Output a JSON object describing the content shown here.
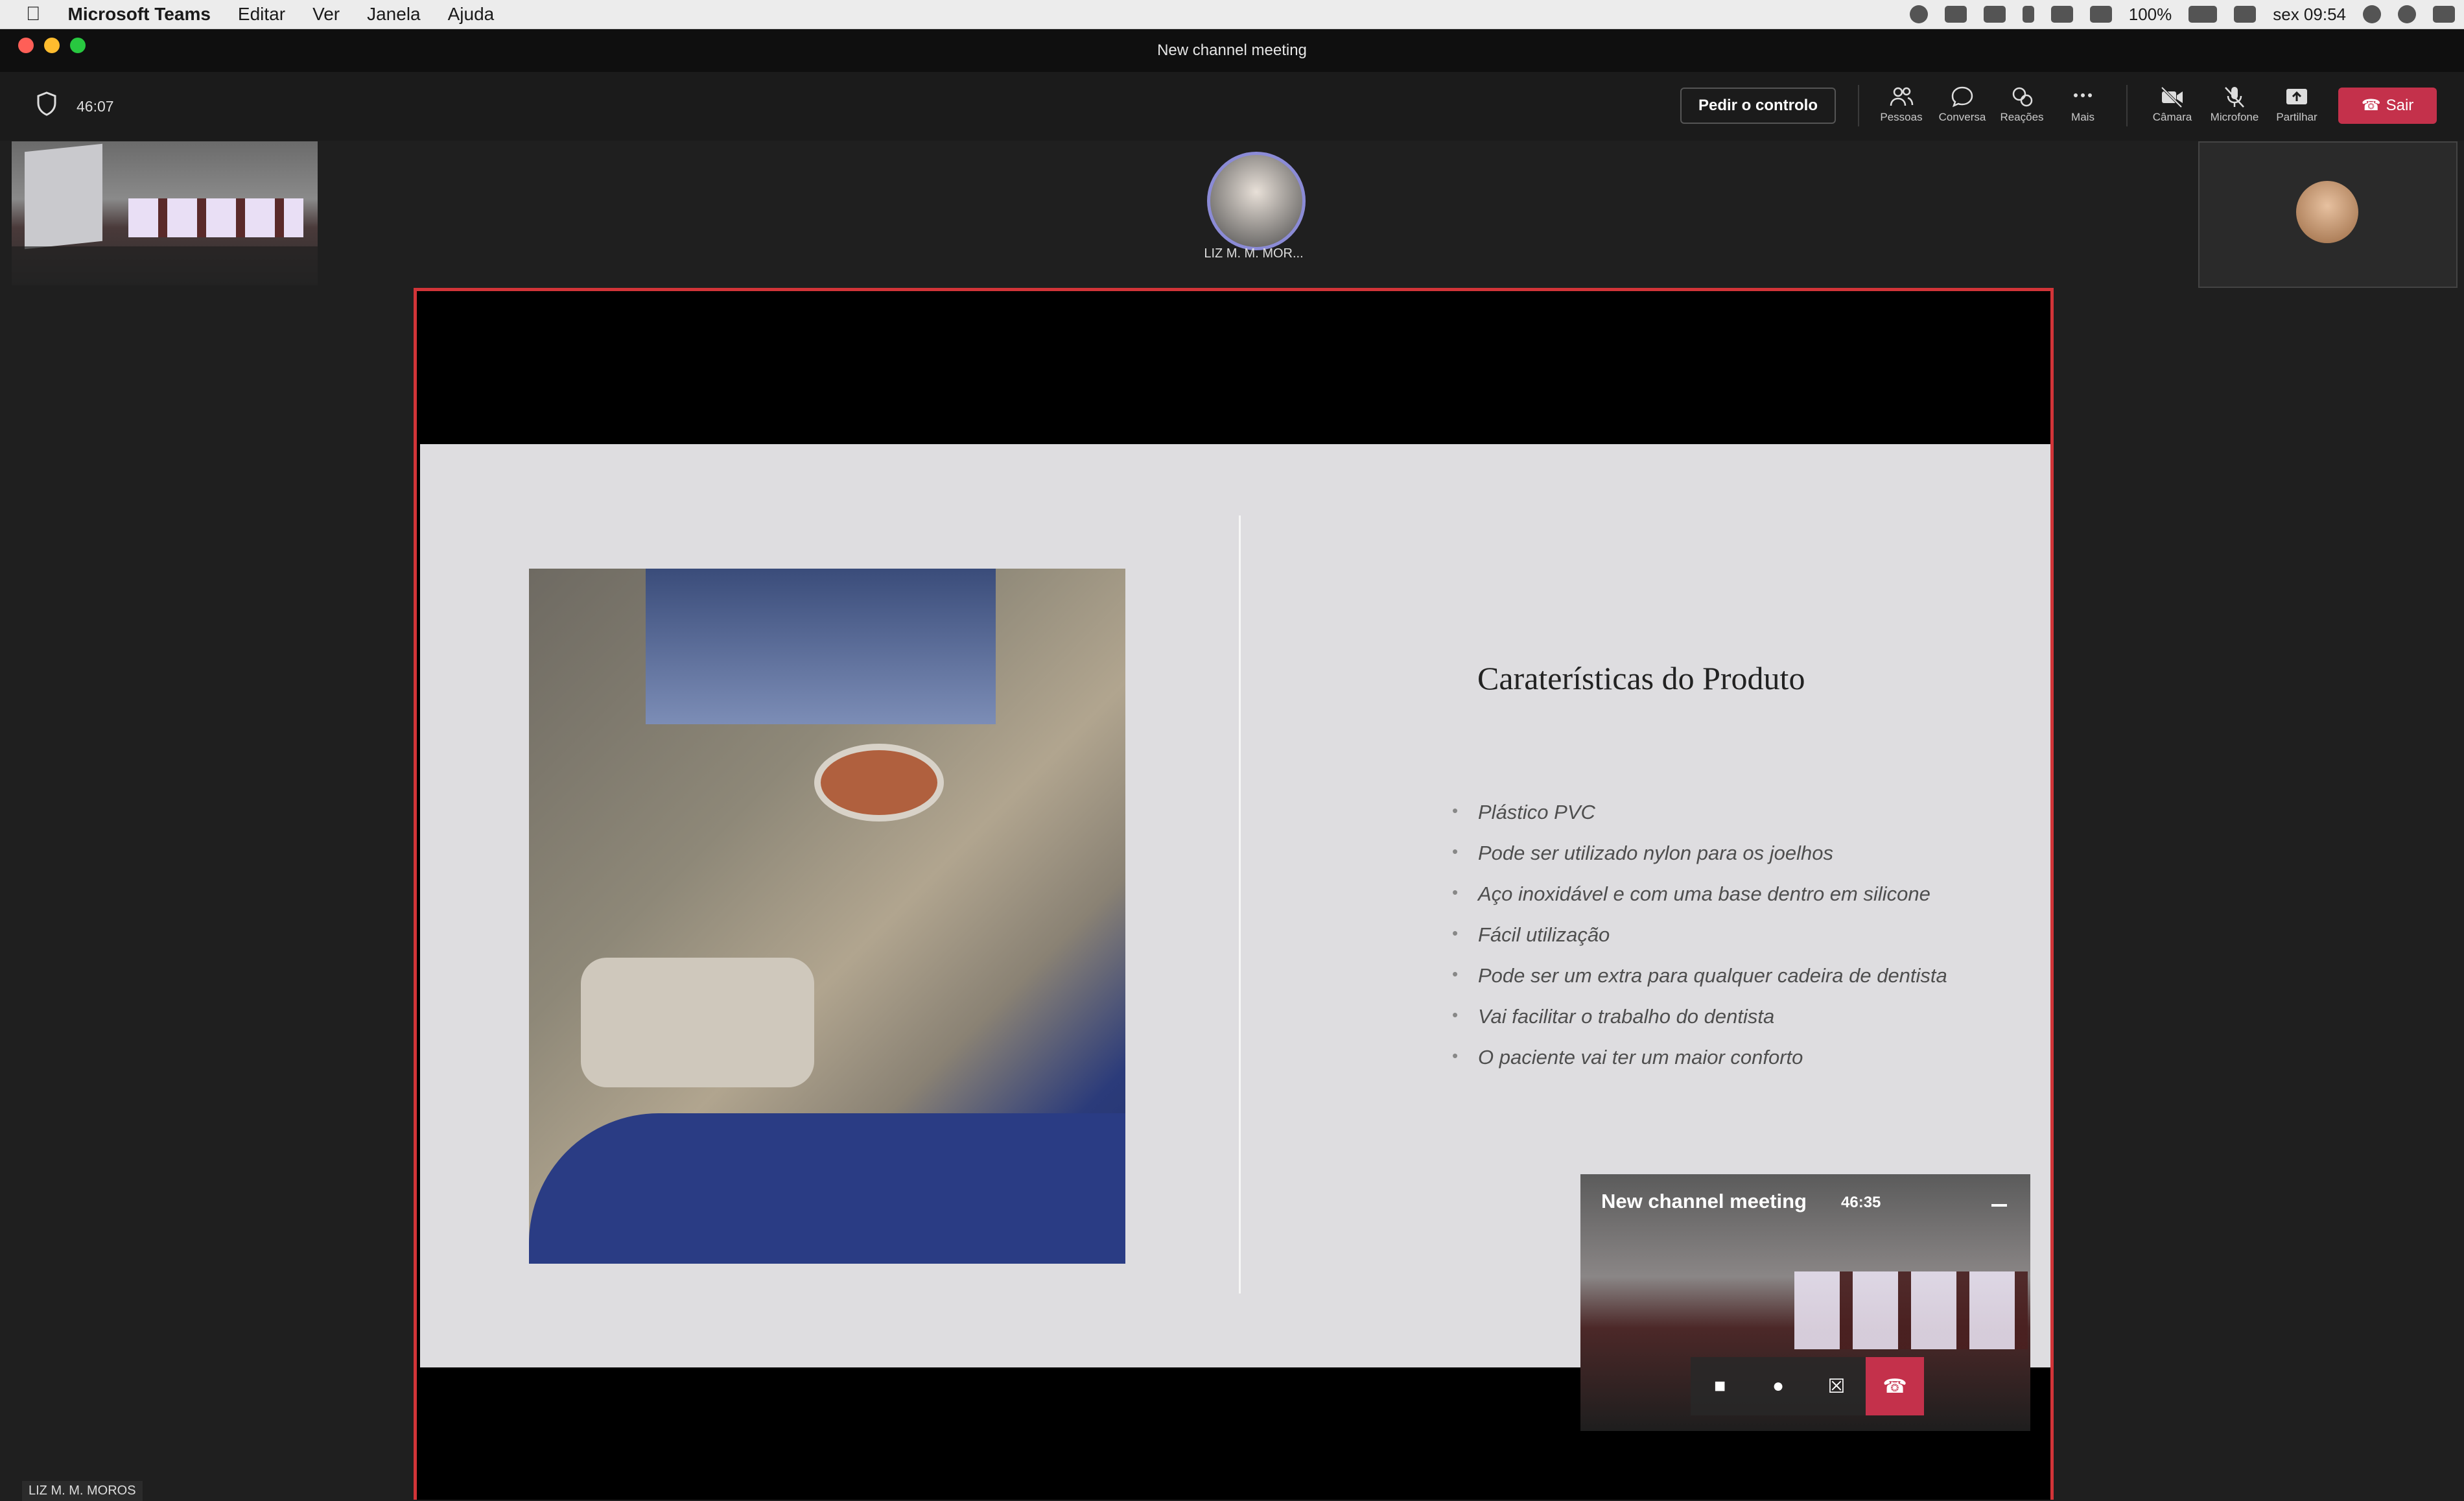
{
  "menubar": {
    "app_name": "Microsoft Teams",
    "menus": [
      "Editar",
      "Ver",
      "Janela",
      "Ajuda"
    ],
    "battery": "100%",
    "clock": "sex 09:54"
  },
  "window": {
    "title": "New channel meeting"
  },
  "toolbar": {
    "elapsed": "46:07",
    "request_control_label": "Pedir o controlo",
    "people_label": "Pessoas",
    "chat_label": "Conversa",
    "reactions_label": "Reações",
    "more_label": "Mais",
    "camera_label": "Câmara",
    "mic_label": "Microfone",
    "share_label": "Partilhar",
    "leave_label": "Sair"
  },
  "participants": {
    "center_name": "LIZ M. M. MOR...",
    "bottom_name": "LIZ M. M. MOROS"
  },
  "slide": {
    "title": "Caraterísticas do Produto",
    "bullets": [
      "Plástico PVC",
      "Pode ser utilizado nylon para os joelhos",
      "Aço inoxidável e com uma base dentro em silicone",
      "Fácil utilização",
      "Pode ser um extra para qualquer cadeira de dentista",
      "Vai facilitar o trabalho do dentista",
      "O paciente vai ter um maior conforto"
    ]
  },
  "mini_window": {
    "title": "New channel meeting",
    "elapsed": "46:35"
  },
  "colors": {
    "leave": "#c4314b",
    "share_border": "#d13438",
    "avatar_ring": "#8b8bd6"
  }
}
